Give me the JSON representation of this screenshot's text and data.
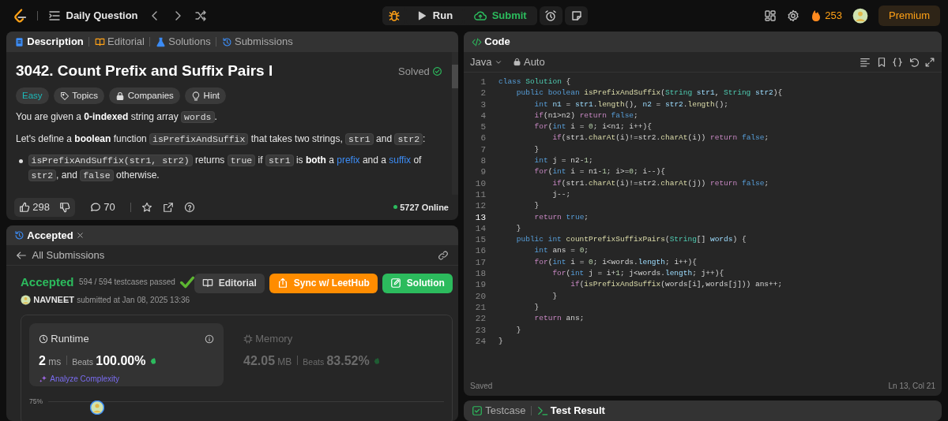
{
  "nav": {
    "title": "Daily Question",
    "run": "Run",
    "submit": "Submit",
    "streak": "253",
    "premium": "Premium"
  },
  "description_tabs": [
    {
      "label": "Description",
      "selected": true
    },
    {
      "label": "Editorial",
      "selected": false
    },
    {
      "label": "Solutions",
      "selected": false
    },
    {
      "label": "Submissions",
      "selected": false
    }
  ],
  "problem": {
    "title": "3042. Count Prefix and Suffix Pairs I",
    "status": "Solved",
    "solved": true,
    "tags": [
      {
        "label": "Easy",
        "kind": "difficulty"
      },
      {
        "label": "Topics",
        "kind": "tag"
      },
      {
        "label": "Companies",
        "kind": "lock"
      },
      {
        "label": "Hint",
        "kind": "bulb"
      }
    ],
    "paragraphs": [
      {
        "kind": "para",
        "segments": [
          {
            "kind": "text",
            "text": "You are given a "
          },
          {
            "kind": "bold",
            "text": "0-indexed"
          },
          {
            "kind": "text",
            "text": " string array "
          },
          {
            "kind": "code",
            "text": "words"
          },
          {
            "kind": "text",
            "text": "."
          }
        ]
      },
      {
        "kind": "para",
        "segments": [
          {
            "kind": "text",
            "text": "Let's define a "
          },
          {
            "kind": "bold",
            "text": "boolean"
          },
          {
            "kind": "text",
            "text": " function "
          },
          {
            "kind": "code",
            "text": "isPrefixAndSuffix"
          },
          {
            "kind": "text",
            "text": " that takes two strings, "
          },
          {
            "kind": "code",
            "text": "str1"
          },
          {
            "kind": "text",
            "text": " and "
          },
          {
            "kind": "code",
            "text": "str2"
          },
          {
            "kind": "text",
            "text": ":"
          }
        ]
      },
      {
        "kind": "bullet",
        "segments": [
          {
            "kind": "code",
            "text": "isPrefixAndSuffix(str1, str2)"
          },
          {
            "kind": "text",
            "text": " returns "
          },
          {
            "kind": "code",
            "text": "true"
          },
          {
            "kind": "text",
            "text": " if "
          },
          {
            "kind": "code",
            "text": "str1"
          },
          {
            "kind": "text",
            "text": " is "
          },
          {
            "kind": "bold",
            "text": "both"
          },
          {
            "kind": "text",
            "text": " a "
          },
          {
            "kind": "link",
            "text": "prefix"
          },
          {
            "kind": "text",
            "text": " and a "
          },
          {
            "kind": "link",
            "text": "suffix"
          },
          {
            "kind": "text",
            "text": " of "
          },
          {
            "kind": "code",
            "text": "str2"
          },
          {
            "kind": "text",
            "text": ", and "
          },
          {
            "kind": "code",
            "text": "false"
          },
          {
            "kind": "text",
            "text": " otherwise."
          }
        ]
      }
    ]
  },
  "footer": {
    "likes": "298",
    "comments": "70",
    "online": "5727 Online"
  },
  "result": {
    "tab": "Accepted",
    "back": "All Submissions",
    "verdict": "Accepted",
    "passed": "594 / 594 testcases passed",
    "user": "NAVNEET",
    "submitted": "submitted at Jan 08, 2025 13:36",
    "buttons": [
      {
        "label": "Editorial",
        "kind": "gray"
      },
      {
        "label": "Sync w/ LeetHub",
        "kind": "orange"
      },
      {
        "label": "Solution",
        "kind": "green"
      }
    ],
    "stats": [
      {
        "title": "Runtime",
        "value": "2",
        "unit": "ms",
        "beats_label": "Beats",
        "beats": "100.00%",
        "selected": true,
        "extra": "Analyze Complexity"
      },
      {
        "title": "Memory",
        "value": "42.05",
        "unit": "MB",
        "beats_label": "Beats",
        "beats": "83.52%",
        "selected": false
      }
    ],
    "chart_tick": "75%"
  },
  "code": {
    "title": "Code",
    "language": "Java",
    "mode": "Auto",
    "saved": "Saved",
    "position": "Ln 13, Col 21",
    "lines": [
      {
        "number": "1",
        "tokens": [
          {
            "kind": "decl",
            "text": "class "
          },
          {
            "kind": "type",
            "text": "Solution"
          },
          {
            "kind": "plain",
            "text": " {"
          }
        ]
      },
      {
        "number": "2",
        "tokens": [
          {
            "kind": "decl",
            "text": "    public boolean "
          },
          {
            "kind": "fn",
            "text": "isPrefixAndSuffix"
          },
          {
            "kind": "plain",
            "text": "("
          },
          {
            "kind": "type",
            "text": "String"
          },
          {
            "kind": "var",
            "text": " str1"
          },
          {
            "kind": "plain",
            "text": ", "
          },
          {
            "kind": "type",
            "text": "String"
          },
          {
            "kind": "var",
            "text": " str2"
          },
          {
            "kind": "plain",
            "text": "){"
          }
        ]
      },
      {
        "number": "3",
        "tokens": [
          {
            "kind": "decl",
            "text": "        int"
          },
          {
            "kind": "var",
            "text": " n1"
          },
          {
            "kind": "plain",
            "text": " = "
          },
          {
            "kind": "var",
            "text": "str1"
          },
          {
            "kind": "plain",
            "text": "."
          },
          {
            "kind": "fn",
            "text": "length"
          },
          {
            "kind": "plain",
            "text": "(), "
          },
          {
            "kind": "var",
            "text": "n2"
          },
          {
            "kind": "plain",
            "text": " = "
          },
          {
            "kind": "var",
            "text": "str2"
          },
          {
            "kind": "plain",
            "text": "."
          },
          {
            "kind": "fn",
            "text": "length"
          },
          {
            "kind": "plain",
            "text": "();"
          }
        ]
      },
      {
        "number": "4",
        "tokens": [
          {
            "kind": "ctl",
            "text": "        if"
          },
          {
            "kind": "plain",
            "text": "(n1>n2) "
          },
          {
            "kind": "ctl",
            "text": "return"
          },
          {
            "kind": "decl",
            "text": " false"
          },
          {
            "kind": "plain",
            "text": ";"
          }
        ]
      },
      {
        "number": "5",
        "tokens": [
          {
            "kind": "ctl",
            "text": "        for"
          },
          {
            "kind": "plain",
            "text": "("
          },
          {
            "kind": "decl",
            "text": "int"
          },
          {
            "kind": "plain",
            "text": " i = "
          },
          {
            "kind": "num",
            "text": "0"
          },
          {
            "kind": "plain",
            "text": "; i<n1; i++){"
          }
        ]
      },
      {
        "number": "6",
        "tokens": [
          {
            "kind": "ctl",
            "text": "            if"
          },
          {
            "kind": "plain",
            "text": "(str1."
          },
          {
            "kind": "fn",
            "text": "charAt"
          },
          {
            "kind": "plain",
            "text": "(i)!=str2."
          },
          {
            "kind": "fn",
            "text": "charAt"
          },
          {
            "kind": "plain",
            "text": "(i)) "
          },
          {
            "kind": "ctl",
            "text": "return"
          },
          {
            "kind": "decl",
            "text": " false"
          },
          {
            "kind": "plain",
            "text": ";"
          }
        ]
      },
      {
        "number": "7",
        "tokens": [
          {
            "kind": "plain",
            "text": "        }"
          }
        ]
      },
      {
        "number": "8",
        "tokens": [
          {
            "kind": "decl",
            "text": "        int"
          },
          {
            "kind": "plain",
            "text": " j = n2-"
          },
          {
            "kind": "num",
            "text": "1"
          },
          {
            "kind": "plain",
            "text": ";"
          }
        ]
      },
      {
        "number": "9",
        "tokens": [
          {
            "kind": "ctl",
            "text": "        for"
          },
          {
            "kind": "plain",
            "text": "("
          },
          {
            "kind": "decl",
            "text": "int"
          },
          {
            "kind": "plain",
            "text": " i = n1-"
          },
          {
            "kind": "num",
            "text": "1"
          },
          {
            "kind": "plain",
            "text": "; i>="
          },
          {
            "kind": "num",
            "text": "0"
          },
          {
            "kind": "plain",
            "text": "; i--){"
          }
        ]
      },
      {
        "number": "10",
        "tokens": [
          {
            "kind": "ctl",
            "text": "            if"
          },
          {
            "kind": "plain",
            "text": "(str1."
          },
          {
            "kind": "fn",
            "text": "charAt"
          },
          {
            "kind": "plain",
            "text": "(i)!=str2."
          },
          {
            "kind": "fn",
            "text": "charAt"
          },
          {
            "kind": "plain",
            "text": "(j)) "
          },
          {
            "kind": "ctl",
            "text": "return"
          },
          {
            "kind": "decl",
            "text": " false"
          },
          {
            "kind": "plain",
            "text": ";"
          }
        ]
      },
      {
        "number": "11",
        "tokens": [
          {
            "kind": "plain",
            "text": "            j--;"
          }
        ]
      },
      {
        "number": "12",
        "tokens": [
          {
            "kind": "plain",
            "text": "        }"
          }
        ]
      },
      {
        "number": "13",
        "tokens": [
          {
            "kind": "ctl",
            "text": "        return"
          },
          {
            "kind": "decl",
            "text": " true"
          },
          {
            "kind": "plain",
            "text": ";"
          }
        ]
      },
      {
        "number": "14",
        "tokens": [
          {
            "kind": "plain",
            "text": "    }"
          }
        ]
      },
      {
        "number": "15",
        "tokens": [
          {
            "kind": "decl",
            "text": "    public int "
          },
          {
            "kind": "fn",
            "text": "countPrefixSuffixPairs"
          },
          {
            "kind": "plain",
            "text": "("
          },
          {
            "kind": "type",
            "text": "String"
          },
          {
            "kind": "plain",
            "text": "[] "
          },
          {
            "kind": "var",
            "text": "words"
          },
          {
            "kind": "plain",
            "text": ") {"
          }
        ]
      },
      {
        "number": "16",
        "tokens": [
          {
            "kind": "decl",
            "text": "        int"
          },
          {
            "kind": "plain",
            "text": " ans = "
          },
          {
            "kind": "num",
            "text": "0"
          },
          {
            "kind": "plain",
            "text": ";"
          }
        ]
      },
      {
        "number": "17",
        "tokens": [
          {
            "kind": "ctl",
            "text": "        for"
          },
          {
            "kind": "plain",
            "text": "("
          },
          {
            "kind": "decl",
            "text": "int"
          },
          {
            "kind": "plain",
            "text": " i = "
          },
          {
            "kind": "num",
            "text": "0"
          },
          {
            "kind": "plain",
            "text": "; i<words."
          },
          {
            "kind": "var",
            "text": "length"
          },
          {
            "kind": "plain",
            "text": "; i++){"
          }
        ]
      },
      {
        "number": "18",
        "tokens": [
          {
            "kind": "ctl",
            "text": "            for"
          },
          {
            "kind": "plain",
            "text": "("
          },
          {
            "kind": "decl",
            "text": "int"
          },
          {
            "kind": "plain",
            "text": " j = i+"
          },
          {
            "kind": "num",
            "text": "1"
          },
          {
            "kind": "plain",
            "text": "; j<words."
          },
          {
            "kind": "var",
            "text": "length"
          },
          {
            "kind": "plain",
            "text": "; j++){"
          }
        ]
      },
      {
        "number": "19",
        "tokens": [
          {
            "kind": "ctl",
            "text": "                if"
          },
          {
            "kind": "plain",
            "text": "("
          },
          {
            "kind": "fn",
            "text": "isPrefixAndSuffix"
          },
          {
            "kind": "plain",
            "text": "(words[i],words[j])) ans++;"
          }
        ]
      },
      {
        "number": "20",
        "tokens": [
          {
            "kind": "plain",
            "text": "            }"
          }
        ]
      },
      {
        "number": "21",
        "tokens": [
          {
            "kind": "plain",
            "text": "        }"
          }
        ]
      },
      {
        "number": "22",
        "tokens": [
          {
            "kind": "ctl",
            "text": "        return"
          },
          {
            "kind": "plain",
            "text": " ans;"
          }
        ]
      },
      {
        "number": "23",
        "tokens": [
          {
            "kind": "plain",
            "text": "    }"
          }
        ]
      },
      {
        "number": "24",
        "tokens": [
          {
            "kind": "plain",
            "text": "}"
          }
        ]
      }
    ]
  },
  "bottom_tabs": [
    {
      "label": "Testcase",
      "selected": false
    },
    {
      "label": "Test Result",
      "selected": true
    }
  ]
}
